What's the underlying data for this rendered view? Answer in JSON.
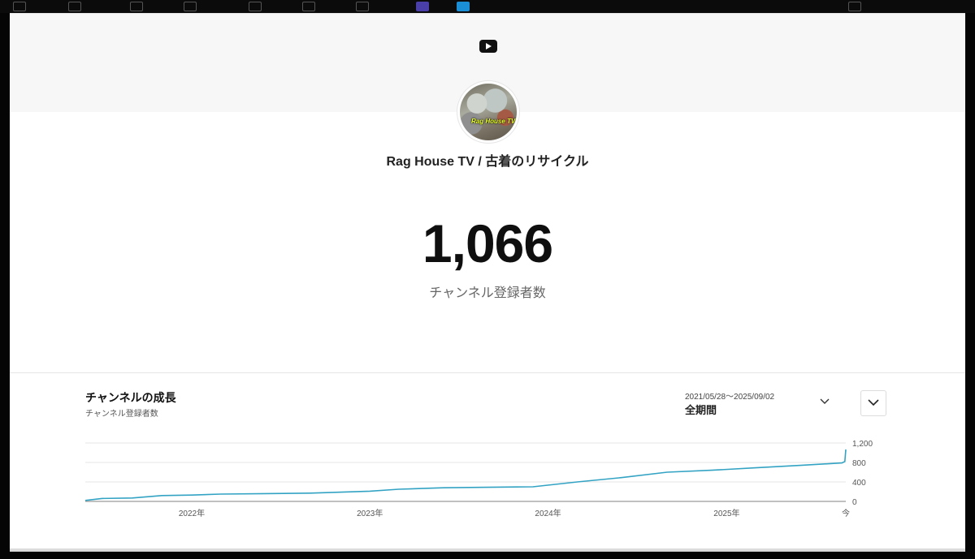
{
  "profile": {
    "channel_name": "Rag House TV / 古着のリサイクル",
    "avatar_caption": "Rag House TV"
  },
  "stats": {
    "subscriber_count": "1,066",
    "subscriber_label": "チャンネル登録者数"
  },
  "growth": {
    "title": "チャンネルの成長",
    "subtitle": "チャンネル登録者数",
    "date_range": "2021/05/28〜2025/09/02",
    "period_label": "全期間"
  },
  "icons": {
    "logo": "youtube-logo-icon",
    "period_toggle": "chevron-down-icon",
    "expand": "chevron-down-icon"
  },
  "colors": {
    "line": "#33a3c4",
    "grid": "#e5e5e5"
  },
  "chart_data": {
    "type": "line",
    "title": "",
    "xlabel": "",
    "ylabel": "",
    "x_ticks": [
      "2022年",
      "2023年",
      "2024年",
      "2025年",
      "今"
    ],
    "y_ticks": [
      0,
      400,
      800,
      1200
    ],
    "y_tick_labels": [
      "0",
      "400",
      "800",
      "1,200"
    ],
    "ylim": [
      0,
      1200
    ],
    "xlim": [
      "2021-05-28",
      "2025-09-02"
    ],
    "grid": true,
    "y_axis_position": "right",
    "series": [
      {
        "x": [
          "2021-05-28",
          "2021-07-01",
          "2021-09-01",
          "2021-11-01",
          "2022-01-01",
          "2022-03-01",
          "2022-06-01",
          "2022-09-01",
          "2023-01-01",
          "2023-03-01",
          "2023-06-01",
          "2023-09-01",
          "2023-12-01",
          "2024-03-01",
          "2024-06-01",
          "2024-09-01",
          "2024-12-01",
          "2025-03-01",
          "2025-06-01",
          "2025-08-25",
          "2025-08-31",
          "2025-09-02"
        ],
        "values": [
          20,
          60,
          70,
          120,
          130,
          150,
          160,
          170,
          210,
          250,
          280,
          290,
          300,
          400,
          490,
          600,
          640,
          690,
          740,
          790,
          820,
          1066
        ]
      }
    ]
  }
}
